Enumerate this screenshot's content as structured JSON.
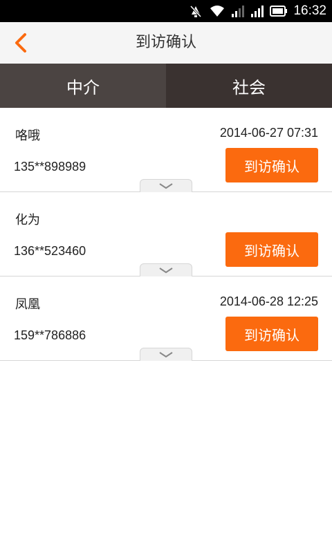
{
  "status_bar": {
    "time": "16:32",
    "icons": [
      "notification-muted-icon",
      "wifi-icon",
      "signal-weak-icon",
      "signal-icon",
      "battery-icon"
    ]
  },
  "header": {
    "title": "到访确认",
    "back_icon": "chevron-left-icon"
  },
  "tabs": [
    {
      "label": "中介",
      "active": true
    },
    {
      "label": "社会",
      "active": false
    }
  ],
  "items": [
    {
      "name": "咯哦",
      "date": "2014-06-27 07:31",
      "phone": "135**898989",
      "button": "到访确认"
    },
    {
      "name": "化为",
      "date": "",
      "phone": "136**523460",
      "button": "到访确认"
    },
    {
      "name": "凤凰",
      "date": "2014-06-28 12:25",
      "phone": "159**786886",
      "button": "到访确认"
    }
  ],
  "colors": {
    "accent": "#fb6a0f",
    "tab_active": "#4b4442",
    "tab_inactive": "#3a3230"
  }
}
